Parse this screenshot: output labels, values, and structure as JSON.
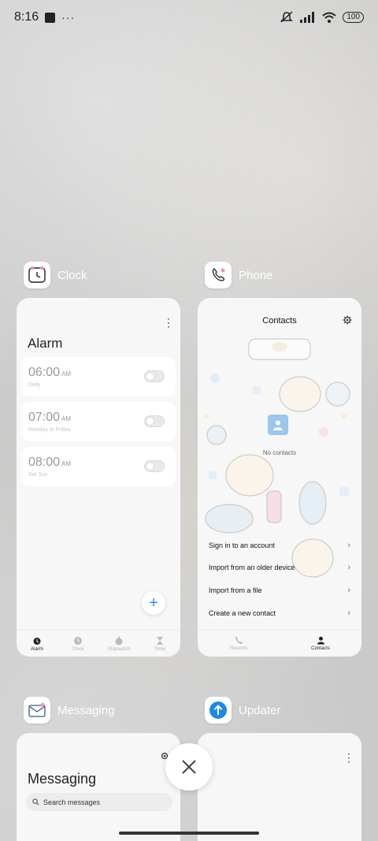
{
  "status_bar": {
    "time": "8:16",
    "dots": "···",
    "battery": "100"
  },
  "apps": {
    "clock": {
      "name": "Clock"
    },
    "phone": {
      "name": "Phone"
    },
    "messaging": {
      "name": "Messaging"
    },
    "updater": {
      "name": "Updater"
    }
  },
  "clock_screen": {
    "title": "Alarm",
    "alarms": [
      {
        "time": "06:00",
        "ampm": "AM",
        "repeat": "Daily",
        "enabled": false
      },
      {
        "time": "07:00",
        "ampm": "AM",
        "repeat": "Monday to Friday",
        "enabled": false
      },
      {
        "time": "08:00",
        "ampm": "AM",
        "repeat": "Sat Sun",
        "enabled": false
      }
    ],
    "fab": "+",
    "nav": [
      {
        "label": "Alarm",
        "icon": "alarm-icon",
        "active": true
      },
      {
        "label": "Clock",
        "icon": "clock-icon",
        "active": false
      },
      {
        "label": "Stopwatch",
        "icon": "stopwatch-icon",
        "active": false
      },
      {
        "label": "Timer",
        "icon": "hourglass-icon",
        "active": false
      }
    ]
  },
  "phone_screen": {
    "title": "Contacts",
    "empty_text": "No contacts",
    "actions": [
      {
        "label": "Sign in to an account"
      },
      {
        "label": "Import from an older device"
      },
      {
        "label": "Import from a file"
      },
      {
        "label": "Create a new contact"
      }
    ],
    "nav": [
      {
        "label": "Recents",
        "icon": "phone-handset-icon",
        "active": false
      },
      {
        "label": "Contacts",
        "icon": "person-icon",
        "active": true
      }
    ]
  },
  "messaging_screen": {
    "title": "Messaging",
    "search_placeholder": "Search messages"
  },
  "colors": {
    "accent": "#2f8cf0",
    "updater_icon": "#1e88e5"
  }
}
